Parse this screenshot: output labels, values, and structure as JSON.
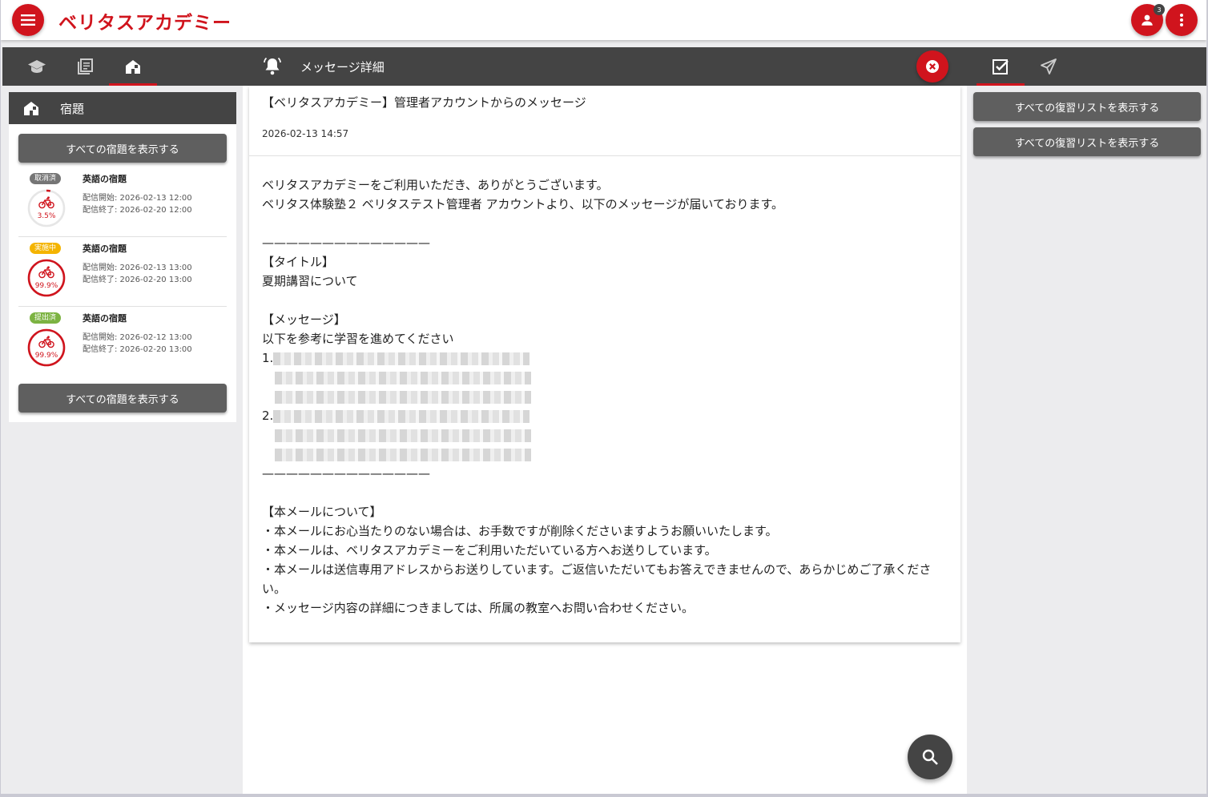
{
  "header": {
    "brand": "ベリタスアカデミー",
    "notification_count": "3",
    "menu_icon": "hamburger-menu-icon",
    "user_icon": "user-icon",
    "more_icon": "more-vertical-icon"
  },
  "left": {
    "tabs": [
      "graduation-cap-icon",
      "book-icon",
      "house-icon"
    ],
    "panel_title": "宿題",
    "show_all_label": "すべての宿題を表示する",
    "homework": [
      {
        "status": "取消済",
        "status_color": "#757575",
        "title": "英語の宿題",
        "progress_label": "3.5%",
        "progress": 0.035,
        "start": "配信開始: 2026-02-13 12:00",
        "end": "配信終了: 2026-02-20 12:00"
      },
      {
        "status": "実施中",
        "status_color": "#f4b400",
        "title": "英語の宿題",
        "progress_label": "99.9%",
        "progress": 0.999,
        "start": "配信開始: 2026-02-13 13:00",
        "end": "配信終了: 2026-02-20 13:00"
      },
      {
        "status": "提出済",
        "status_color": "#7cb342",
        "title": "英語の宿題",
        "progress_label": "99.9%",
        "progress": 0.999,
        "start": "配信開始: 2026-02-12 13:00",
        "end": "配信終了: 2026-02-20 13:00"
      }
    ]
  },
  "middle": {
    "title": "メッセージ詳細",
    "subject": "【ベリタスアカデミー】管理者アカウントからのメッセージ",
    "datetime": "2026-02-13 14:57",
    "body": {
      "l1": "ベリタスアカデミーをご利用いただき、ありがとうございます。",
      "l2": "ベリタス体験塾２ ベリタステスト管理者 アカウントより、以下のメッセージが届いております。",
      "rule": "——————————————",
      "title_head": "【タイトル】",
      "title_text": "夏期講習について",
      "msg_head": "【メッセージ】",
      "msg_text": "以下を参考に学習を進めてください",
      "item1": "1.",
      "item2": "2.",
      "about_head": "【本メールについて】",
      "about1": "・本メールにお心当たりのない場合は、お手数ですが削除くださいますようお願いいたします。",
      "about2": "・本メールは、ベリタスアカデミーをご利用いただいている方へお送りしています。",
      "about3": "・本メールは送信専用アドレスからお送りしています。ご返信いただいてもお答えできませんので、あらかじめご了承ください。",
      "about4": "・メッセージ内容の詳細につきましては、所属の教室へお問い合わせください。"
    }
  },
  "right": {
    "tabs": [
      "checkbox-icon",
      "send-icon"
    ],
    "btn1": "すべての復習リストを表示する",
    "btn2": "すべての復習リストを表示する"
  },
  "colors": {
    "accent": "#d0141d",
    "dark": "#444444",
    "button": "#5f5f5f"
  }
}
